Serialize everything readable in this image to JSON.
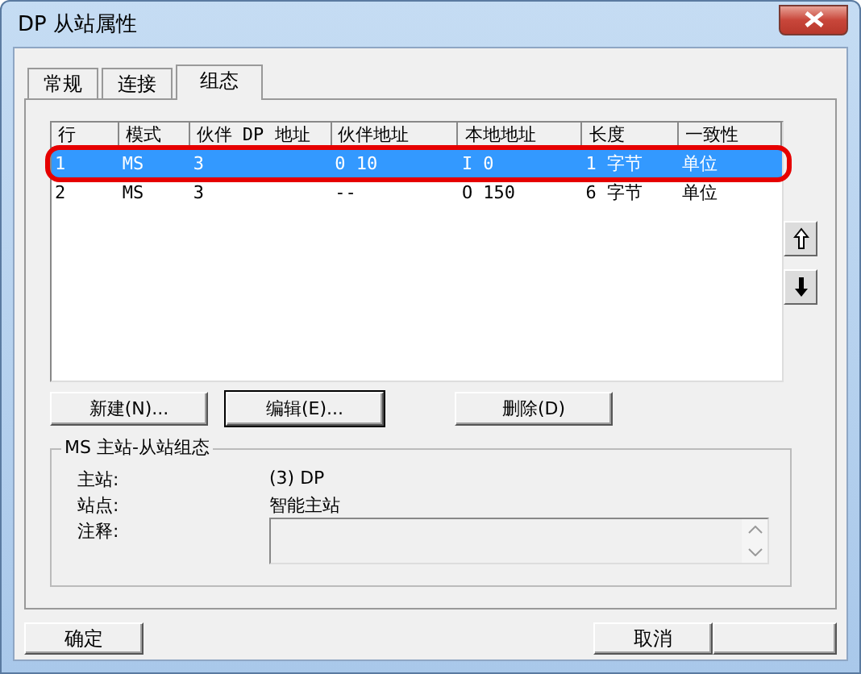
{
  "window": {
    "title": "DP 从站属性"
  },
  "tabs": [
    {
      "label": "常规",
      "selected": false
    },
    {
      "label": "连接",
      "selected": false
    },
    {
      "label": "组态",
      "selected": true
    }
  ],
  "table": {
    "columns": [
      "行",
      "模式",
      "伙伴 DP 地址",
      "伙伴地址",
      "本地地址",
      "长度",
      "一致性"
    ],
    "rows": [
      {
        "cells": [
          "1",
          "MS",
          "3",
          "0 10",
          "I 0",
          "1 字节",
          "单位"
        ],
        "selected": true,
        "circled": true
      },
      {
        "cells": [
          "2",
          "MS",
          "3",
          "--",
          "O 150",
          "6 字节",
          "单位"
        ],
        "selected": false,
        "circled": false
      }
    ]
  },
  "row_buttons": [
    "新建(N)...",
    "编辑(E)...",
    "删除(D)"
  ],
  "group": {
    "title": "MS 主站-从站组态",
    "fields": [
      {
        "label": "主站:",
        "value": "(3) DP",
        "kind": "text"
      },
      {
        "label": "站点:",
        "value": "智能主站",
        "kind": "text"
      },
      {
        "label": "注释:",
        "kind": "textarea"
      }
    ]
  },
  "footer_buttons": [
    "确定",
    "取消"
  ]
}
